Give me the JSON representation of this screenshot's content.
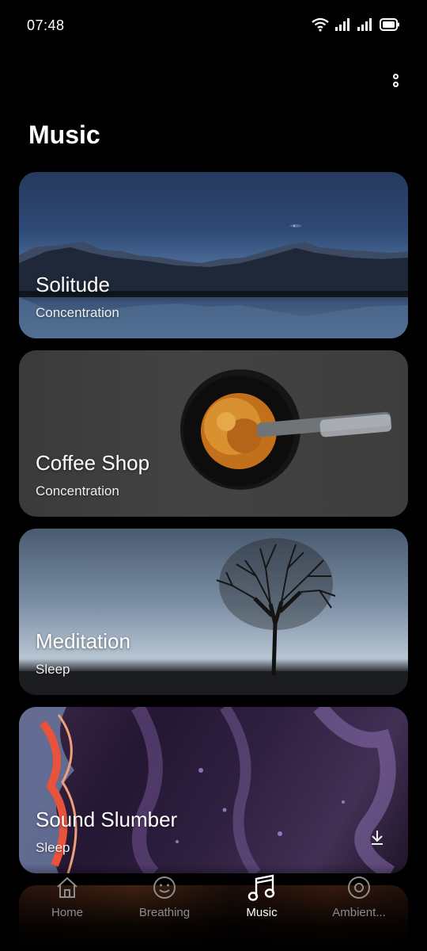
{
  "status": {
    "time": "07:48",
    "icons": [
      "wifi-icon",
      "signal-icon",
      "signal-icon",
      "battery-icon"
    ]
  },
  "header": {
    "more_icon": "more-vertical-icon",
    "title": "Music"
  },
  "cards": [
    {
      "title": "Solitude",
      "subtitle": "Concentration"
    },
    {
      "title": "Coffee Shop",
      "subtitle": "Concentration"
    },
    {
      "title": "Meditation",
      "subtitle": "Sleep"
    },
    {
      "title": "Sound Slumber",
      "subtitle": "Sleep",
      "action_icon": "download-icon"
    }
  ],
  "nav": {
    "items": [
      {
        "label": "Home",
        "icon": "home-icon",
        "active": false
      },
      {
        "label": "Breathing",
        "icon": "smile-icon",
        "active": false
      },
      {
        "label": "Music",
        "icon": "music-note-icon",
        "active": true
      },
      {
        "label": "Ambient...",
        "icon": "disc-icon",
        "active": false
      }
    ]
  },
  "colors": {
    "background": "#000000",
    "active_nav": "#ffffff",
    "inactive_nav": "#8c8c8c"
  }
}
